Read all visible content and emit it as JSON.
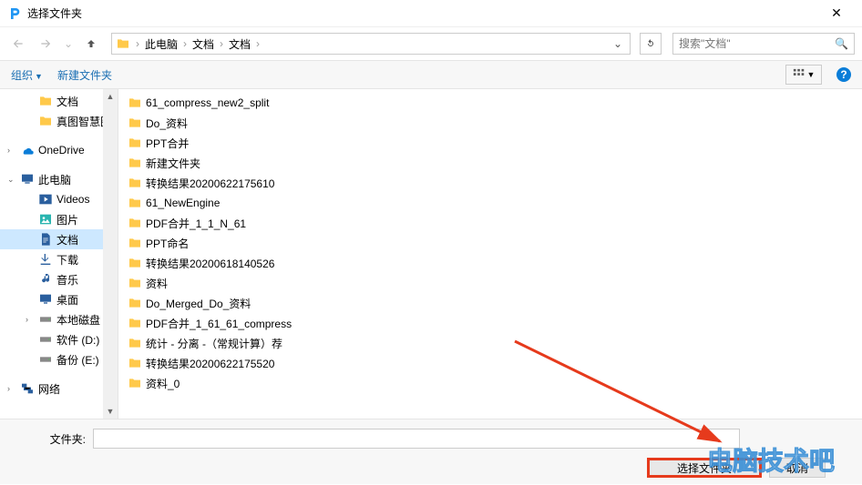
{
  "window": {
    "title": "选择文件夹",
    "close": "✕"
  },
  "breadcrumbs": [
    "此电脑",
    "文档",
    "文档"
  ],
  "search": {
    "placeholder": "搜索\"文档\""
  },
  "toolbar": {
    "organize": "组织",
    "newfolder": "新建文件夹",
    "help": "?"
  },
  "sidebar": {
    "items": [
      {
        "label": "文档",
        "icon": "folder",
        "indent": 1
      },
      {
        "label": "真图智慧图",
        "icon": "folder",
        "indent": 1
      },
      {
        "label": "",
        "spacer": true
      },
      {
        "label": "OneDrive",
        "icon": "onedrive",
        "indent": 0,
        "exp": "›"
      },
      {
        "label": "",
        "spacer": true
      },
      {
        "label": "此电脑",
        "icon": "pc",
        "indent": 0,
        "exp": "⌄"
      },
      {
        "label": "Videos",
        "icon": "videos",
        "indent": 1
      },
      {
        "label": "图片",
        "icon": "pictures",
        "indent": 1
      },
      {
        "label": "文档",
        "icon": "docs",
        "indent": 1,
        "sel": true
      },
      {
        "label": "下载",
        "icon": "downloads",
        "indent": 1
      },
      {
        "label": "音乐",
        "icon": "music",
        "indent": 1
      },
      {
        "label": "桌面",
        "icon": "desktop",
        "indent": 1
      },
      {
        "label": "本地磁盘 (C",
        "icon": "disk",
        "indent": 1,
        "exp": "›"
      },
      {
        "label": "软件 (D:)",
        "icon": "disk",
        "indent": 1
      },
      {
        "label": "备份 (E:)",
        "icon": "disk",
        "indent": 1
      },
      {
        "label": "",
        "spacer": true
      },
      {
        "label": "网络",
        "icon": "network",
        "indent": 0,
        "exp": "›"
      }
    ]
  },
  "files": [
    "61_compress_new2_split",
    "Do_资料",
    "PPT合并",
    "新建文件夹",
    "转换结果20200622175610",
    "61_NewEngine",
    "PDF合并_1_1_N_61",
    "PPT命名",
    "转换结果20200618140526",
    "资料",
    "Do_Merged_Do_资料",
    "PDF合并_1_61_61_compress",
    "统计 - 分离 -（常规计算）荐",
    "转换结果20200622175520",
    "资料_0"
  ],
  "footer": {
    "folderLabel": "文件夹:",
    "select": "选择文件夹",
    "cancel": "取消"
  },
  "watermark": "电脑技术吧"
}
